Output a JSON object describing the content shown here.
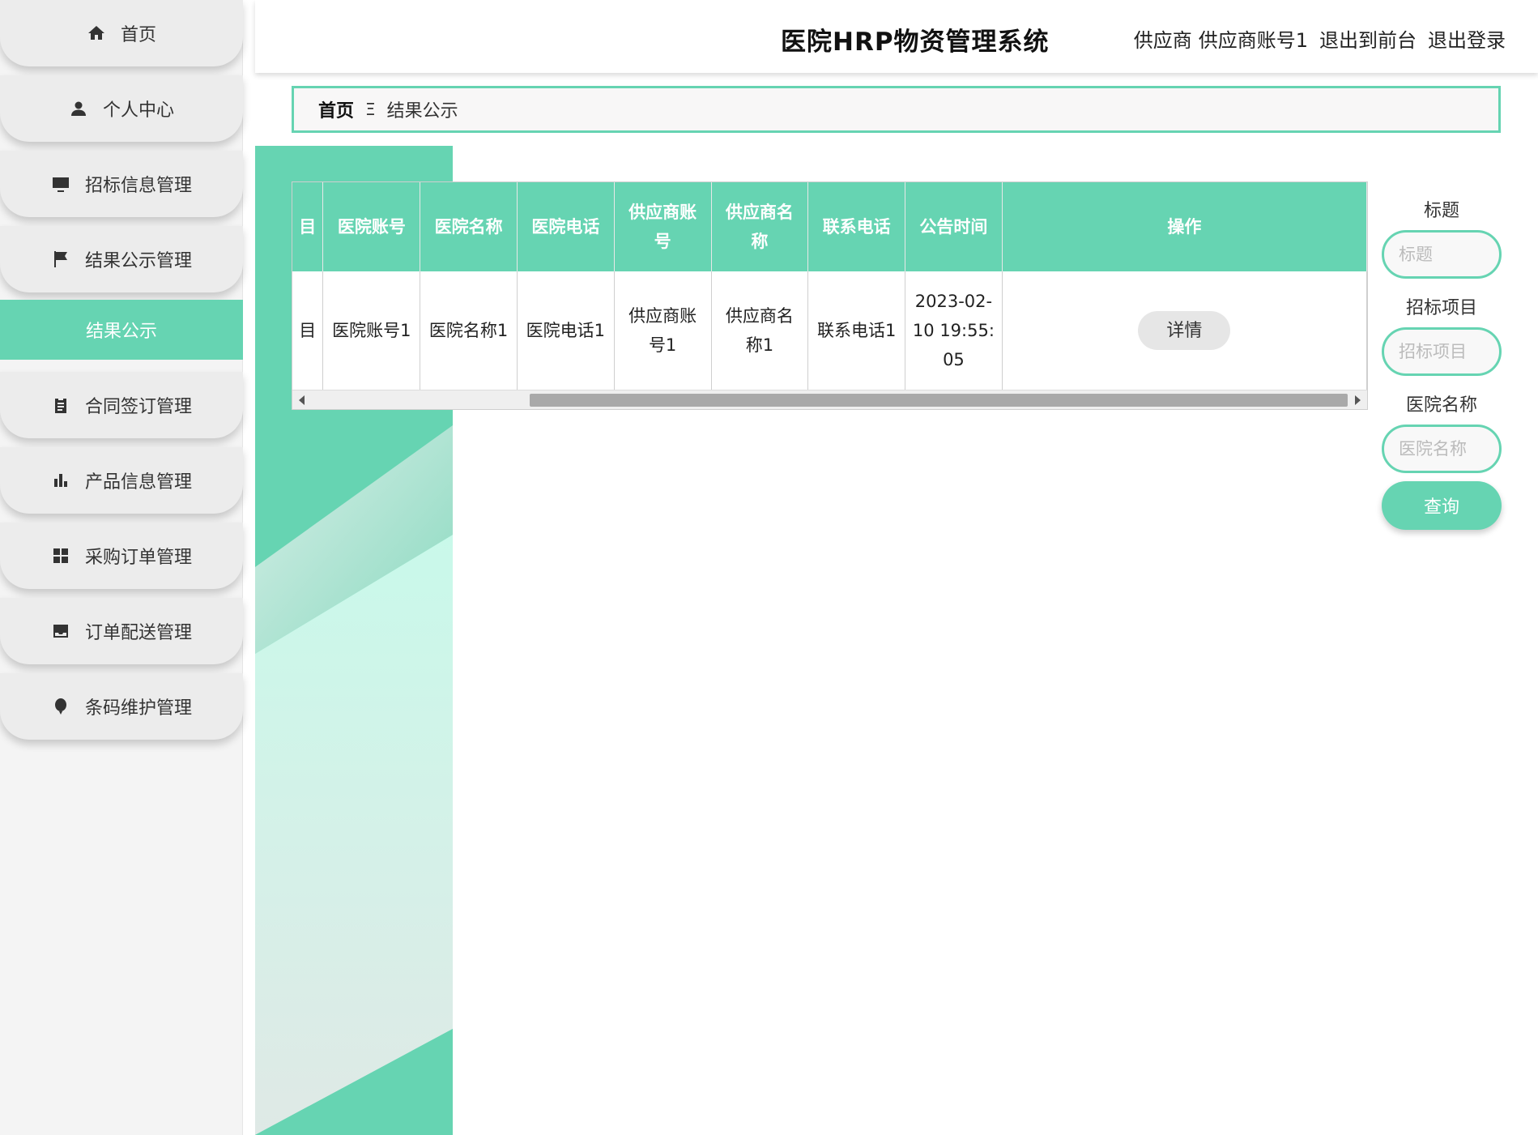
{
  "app": {
    "title": "医院HRP物资管理系统"
  },
  "header": {
    "role": "供应商",
    "account": "供应商账号1",
    "back_to_front": "退出到前台",
    "logout": "退出登录"
  },
  "sidebar": {
    "items": [
      {
        "label": "首页",
        "icon": "home-icon"
      },
      {
        "label": "个人中心",
        "icon": "person-icon"
      },
      {
        "label": "招标信息管理",
        "icon": "monitor-icon"
      },
      {
        "label": "结果公示管理",
        "icon": "flag-icon"
      },
      {
        "label": "合同签订管理",
        "icon": "clipboard-icon"
      },
      {
        "label": "产品信息管理",
        "icon": "bar-chart-icon"
      },
      {
        "label": "采购订单管理",
        "icon": "grid-icon"
      },
      {
        "label": "订单配送管理",
        "icon": "inbox-icon"
      },
      {
        "label": "条码维护管理",
        "icon": "balloon-icon"
      }
    ],
    "active_sub": "结果公示"
  },
  "breadcrumb": {
    "home": "首页",
    "separator": "Ξ",
    "current": "结果公示"
  },
  "table": {
    "headers": [
      "目",
      "医院账号",
      "医院名称",
      "医院电话",
      "供应商账号",
      "供应商名称",
      "联系电话",
      "公告时间",
      "操作"
    ],
    "rows": [
      {
        "c0": "目",
        "hospital_account": "医院账号1",
        "hospital_name": "医院名称1",
        "hospital_phone": "医院电话1",
        "supplier_account": "供应商账号1",
        "supplier_name": "供应商名称1",
        "contact_phone": "联系电话1",
        "announce_time": "2023-02-10 19:55:05",
        "action": "详情"
      }
    ]
  },
  "search": {
    "fields": [
      {
        "label": "标题",
        "placeholder": "标题"
      },
      {
        "label": "招标项目",
        "placeholder": "招标项目"
      },
      {
        "label": "医院名称",
        "placeholder": "医院名称"
      }
    ],
    "button": "查询"
  },
  "colors": {
    "accent": "#66d4b2",
    "sidebar_bg": "#ececec"
  }
}
